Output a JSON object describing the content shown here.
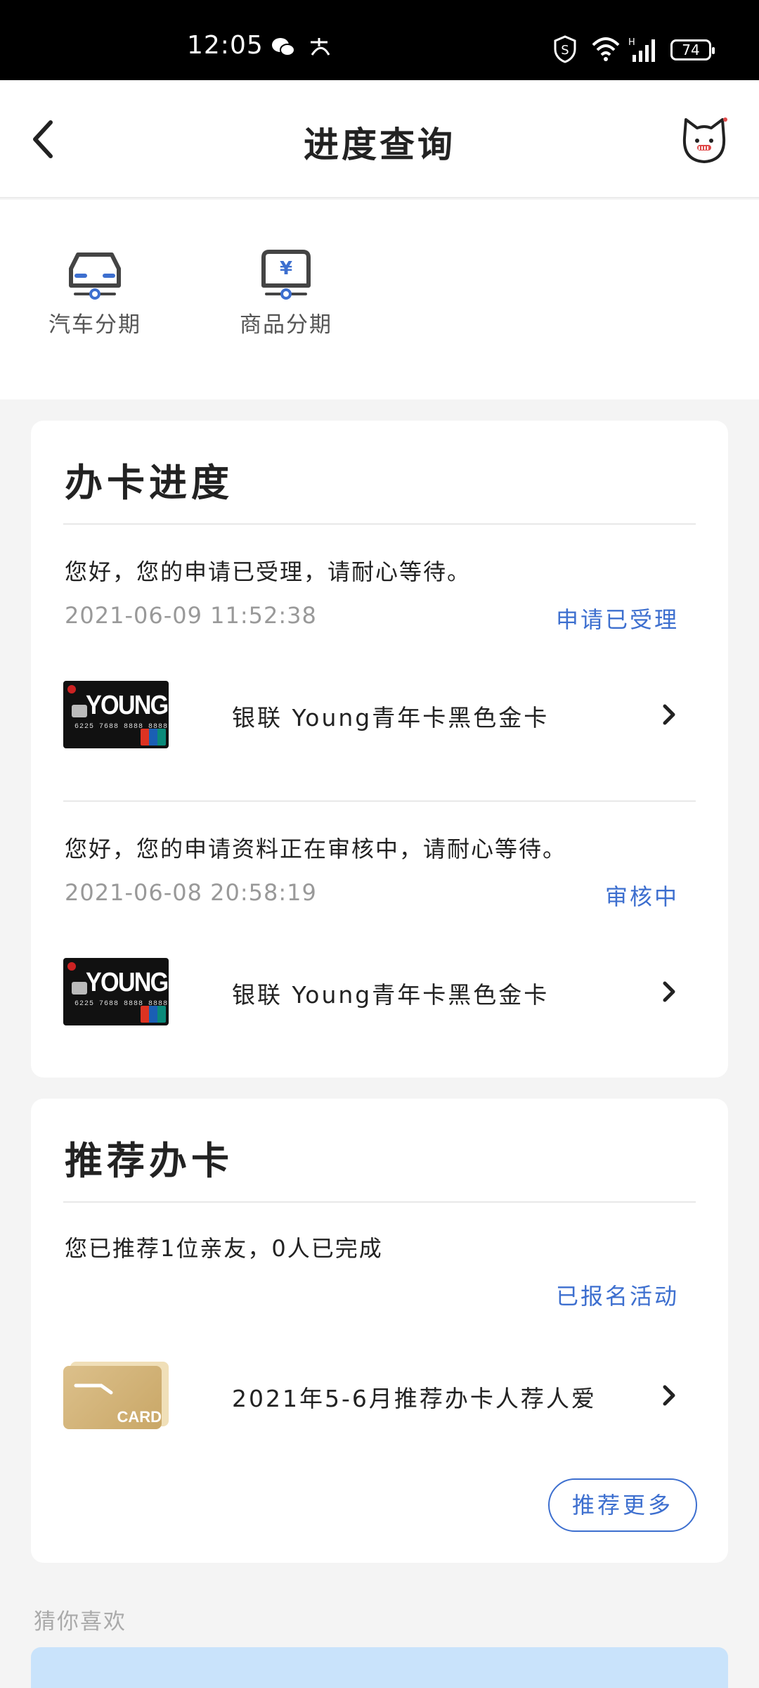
{
  "status_bar": {
    "time": "12:05",
    "battery": "74"
  },
  "header": {
    "title": "进度查询"
  },
  "shortcuts": [
    {
      "label": "汽车分期",
      "icon": "car-icon"
    },
    {
      "label": "商品分期",
      "icon": "shopping-cart-yen-icon"
    }
  ],
  "progress": {
    "title": "办卡进度",
    "items": [
      {
        "message": "您好，您的申请已受理，请耐心等待。",
        "time": "2021-06-09 11:52:38",
        "status": "申请已受理",
        "product": "银联 Young青年卡黑色金卡",
        "card_text": "YOUNG",
        "card_number": "6225 7688 8888 8888"
      },
      {
        "message": "您好，您的申请资料正在审核中，请耐心等待。",
        "time": "2021-06-08 20:58:19",
        "status": "审核中",
        "product": "银联 Young青年卡黑色金卡",
        "card_text": "YOUNG",
        "card_number": "6225 7688 8888 8888"
      }
    ]
  },
  "recommend": {
    "title": "推荐办卡",
    "summary": "您已推荐1位亲友，0人已完成",
    "status": "已报名活动",
    "activity": "2021年5-6月推荐办卡人荐人爱",
    "card_text": "CARD",
    "more_button": "推荐更多"
  },
  "guess": {
    "title": "猜你喜欢"
  },
  "colors": {
    "accent": "#3d6fcf",
    "card_bg": "#ffffff",
    "page_bg": "#f4f4f4"
  }
}
